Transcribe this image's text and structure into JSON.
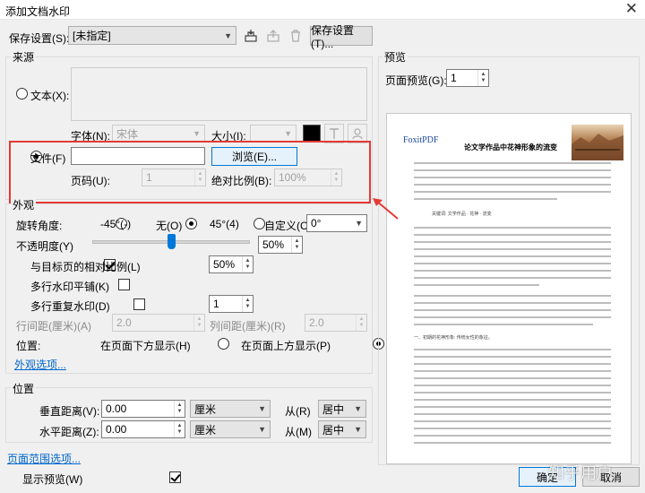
{
  "window": {
    "title": "添加文档水印",
    "close_glyph": "✕"
  },
  "header": {
    "save_settings_label": "保存设置(S):",
    "save_settings_value": "[未指定]",
    "save_settings_button": "保存设置(T)..."
  },
  "source": {
    "group_label": "来源",
    "text_radio_label": "文本(X):",
    "font_label": "字体(N):",
    "font_value": "宋体",
    "size_label": "大小(I):",
    "font_color": "#000000",
    "file_radio_label": "文件(F)",
    "file_path_value": "",
    "browse_button": "浏览(E)...",
    "page_label": "页码(U):",
    "page_value": "1",
    "abs_scale_label": "绝对比例(B):",
    "abs_scale_value": "100%"
  },
  "appearance": {
    "group_label": "外观",
    "rotation_label": "旋转角度:",
    "rot_neg45": "-45°(-)",
    "rot_none": "无(O)",
    "rot_45": "45°(4)",
    "rot_custom": "自定义(C)",
    "rot_custom_value": "0°",
    "opacity_label": "不透明度(Y)",
    "opacity_value": "50%",
    "opacity_level": 0.5,
    "relative_scale_label": "与目标页的相对比例(L)",
    "relative_scale_value": "50%",
    "tile_label": "多行水印平铺(K)",
    "repeat_label": "多行重复水印(D)",
    "repeat_value": "1",
    "row_spacing_label": "行间距(厘米)(A)",
    "row_spacing_value": "2.0",
    "col_spacing_label": "列间距(厘米)(R)",
    "col_spacing_value": "2.0",
    "position_label": "位置:",
    "pos_below": "在页面下方显示(H)",
    "pos_above": "在页面上方显示(P)",
    "more_options_link": "外观选项..."
  },
  "position": {
    "group_label": "位置",
    "vertical_label": "垂直距离(V):",
    "vertical_value": "0.00",
    "vertical_unit": "厘米",
    "vertical_from_label": "从(R)",
    "vertical_from_value": "居中",
    "horizontal_label": "水平距离(Z):",
    "horizontal_value": "0.00",
    "horizontal_unit": "厘米",
    "horizontal_from_label": "从(M)",
    "horizontal_from_value": "居中"
  },
  "footer": {
    "page_range_link": "页面范围选项...",
    "show_preview_label": "显示预览(W)",
    "ok_button": "确定",
    "cancel_button": "取消",
    "zhihu_watermark": "知乎用户"
  },
  "preview": {
    "group_label": "预览",
    "page_preview_label": "页面预览(G):",
    "page_preview_value": "1",
    "watermark_text": "FoxitPDF",
    "doc_title": "论文学作品中花神形象的流变",
    "doc_keywords": "关键词: 文学作品 · 花神 · 流变",
    "doc_section": "一、初期的花神形象: 传统女性的象征。"
  },
  "colors": {
    "accent": "#0078d7",
    "highlight": "#e53935",
    "link": "#0066cc"
  }
}
